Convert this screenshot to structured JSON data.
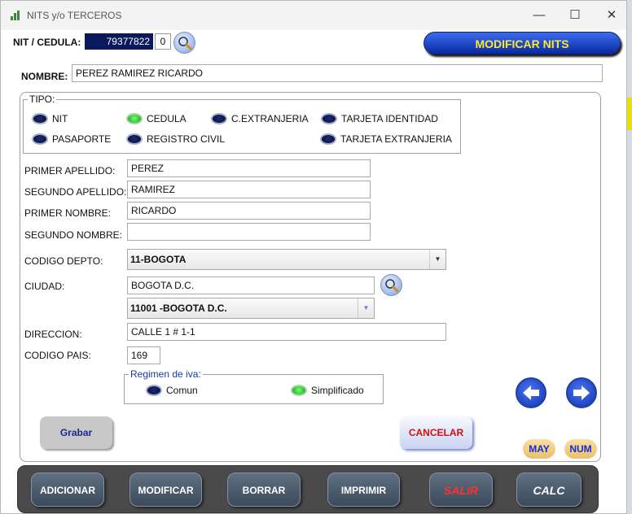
{
  "window": {
    "title": "NITS y/o TERCEROS",
    "minimize": "—",
    "maximize": "☐",
    "close": "✕"
  },
  "header": {
    "nit_label": "NIT / CEDULA:",
    "nit_value": "79377822",
    "dv_value": "0",
    "modify_button": "MODIFICAR NITS"
  },
  "nombre": {
    "label": "NOMBRE:",
    "value": "PEREZ RAMIREZ RICARDO"
  },
  "tipo": {
    "legend": "TIPO:",
    "options": [
      {
        "label": "NIT",
        "selected": false
      },
      {
        "label": "CEDULA",
        "selected": true
      },
      {
        "label": "C.EXTRANJERIA",
        "selected": false
      },
      {
        "label": "TARJETA IDENTIDAD",
        "selected": false
      },
      {
        "label": "PASAPORTE",
        "selected": false
      },
      {
        "label": "REGISTRO CIVIL",
        "selected": false
      },
      {
        "label": "TARJETA EXTRANJERIA",
        "selected": false
      }
    ]
  },
  "fields": {
    "primer_apellido": {
      "label": "PRIMER APELLIDO:",
      "value": "PEREZ"
    },
    "segundo_apellido": {
      "label": "SEGUNDO APELLIDO:",
      "value": "RAMIREZ"
    },
    "primer_nombre": {
      "label": "PRIMER NOMBRE:",
      "value": "RICARDO"
    },
    "segundo_nombre": {
      "label": "SEGUNDO NOMBRE:",
      "value": ""
    },
    "codigo_depto": {
      "label": "CODIGO DEPTO:",
      "value": "11-BOGOTA"
    },
    "ciudad": {
      "label": "CIUDAD:",
      "value": "BOGOTA D.C.",
      "select_value": "11001  -BOGOTA D.C."
    },
    "direccion": {
      "label": "DIRECCION:",
      "value": "CALLE 1 # 1-1"
    },
    "codigo_pais": {
      "label": "CODIGO PAIS:",
      "value": "169"
    }
  },
  "regimen": {
    "legend": "Regimen de iva:",
    "options": [
      {
        "label": "Comun",
        "selected": false
      },
      {
        "label": "Simplificado",
        "selected": true
      }
    ]
  },
  "actions": {
    "grabar": "Grabar",
    "cancelar": "CANCELAR",
    "may": "MAY",
    "num": "NUM"
  },
  "bottom": {
    "adicionar": "ADICIONAR",
    "modificar": "MODIFICAR",
    "borrar": "BORRAR",
    "imprimir": "IMPRIMIR",
    "salir": "SALIR",
    "calc": "CALC"
  },
  "colors": {
    "accent": "#0a2aa0",
    "highlight": "#ffe830",
    "selected_radio": "#10a010",
    "cancel": "#d01010"
  }
}
